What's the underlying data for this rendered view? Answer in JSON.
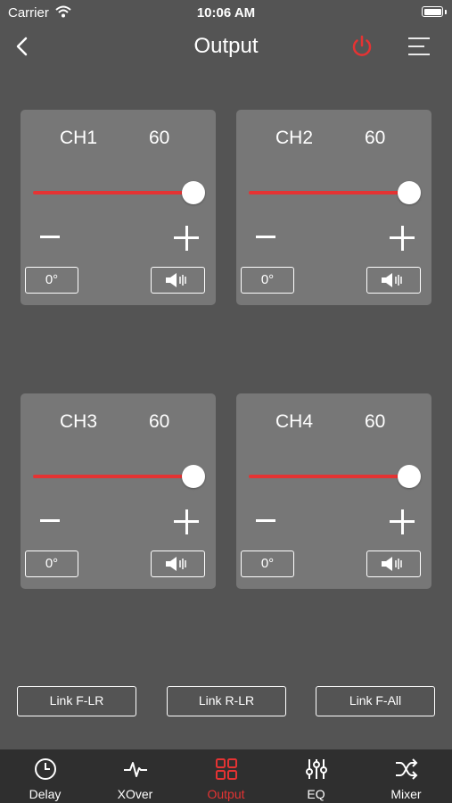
{
  "status_bar": {
    "carrier": "Carrier",
    "time": "10:06 AM"
  },
  "nav": {
    "title": "Output"
  },
  "colors": {
    "accent": "#e53333",
    "card": "#777777",
    "background": "#545454",
    "tabbar": "#2f2f2f"
  },
  "channels": [
    {
      "name": "CH1",
      "value": "60",
      "phase": "0°",
      "level": 1.0
    },
    {
      "name": "CH2",
      "value": "60",
      "phase": "0°",
      "level": 1.0
    },
    {
      "name": "CH3",
      "value": "60",
      "phase": "0°",
      "level": 1.0
    },
    {
      "name": "CH4",
      "value": "60",
      "phase": "0°",
      "level": 1.0
    }
  ],
  "links": [
    {
      "label": "Link F-LR"
    },
    {
      "label": "Link R-LR"
    },
    {
      "label": "Link F-All"
    }
  ],
  "tabs": [
    {
      "label": "Delay",
      "icon": "clock-icon"
    },
    {
      "label": "XOver",
      "icon": "pulse-icon"
    },
    {
      "label": "Output",
      "icon": "grid-icon",
      "active": true
    },
    {
      "label": "EQ",
      "icon": "sliders-icon"
    },
    {
      "label": "Mixer",
      "icon": "shuffle-icon"
    }
  ]
}
